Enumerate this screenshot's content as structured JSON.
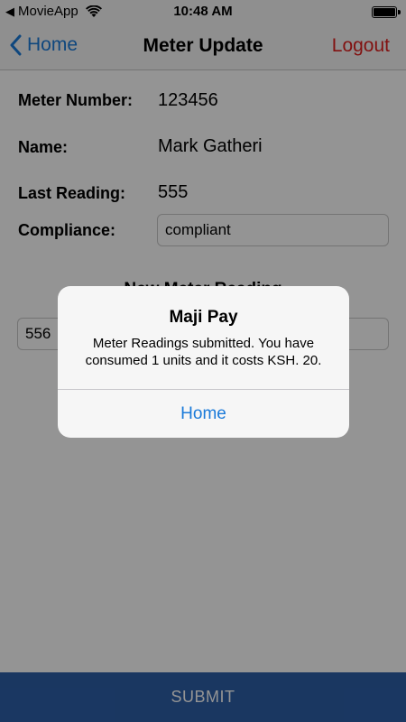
{
  "status_bar": {
    "back_app": "MovieApp",
    "time": "10:48 AM",
    "back_icon": "back-arrow-icon",
    "wifi_icon": "wifi-icon",
    "battery_icon": "battery-icon",
    "battery_level": 1.0
  },
  "nav": {
    "back_label": "Home",
    "title": "Meter Update",
    "logout_label": "Logout",
    "back_icon": "chevron-left-icon",
    "accent_color": "#1a7ad9",
    "logout_color": "#e0201e"
  },
  "form": {
    "meter_number_label": "Meter Number:",
    "meter_number_value": "123456",
    "name_label": "Name:",
    "name_value": "Mark Gatheri",
    "last_reading_label": "Last Reading:",
    "last_reading_value": "555",
    "compliance_label": "Compliance:",
    "compliance_value": "compliant",
    "new_reading_heading": "New Meter Reading",
    "new_reading_value": "556"
  },
  "submit": {
    "label": "SUBMIT",
    "color": "#2d5fa8"
  },
  "alert": {
    "title": "Maji Pay",
    "message": "Meter Readings submitted. You have consumed 1 units and it costs KSH. 20.",
    "button_label": "Home"
  }
}
